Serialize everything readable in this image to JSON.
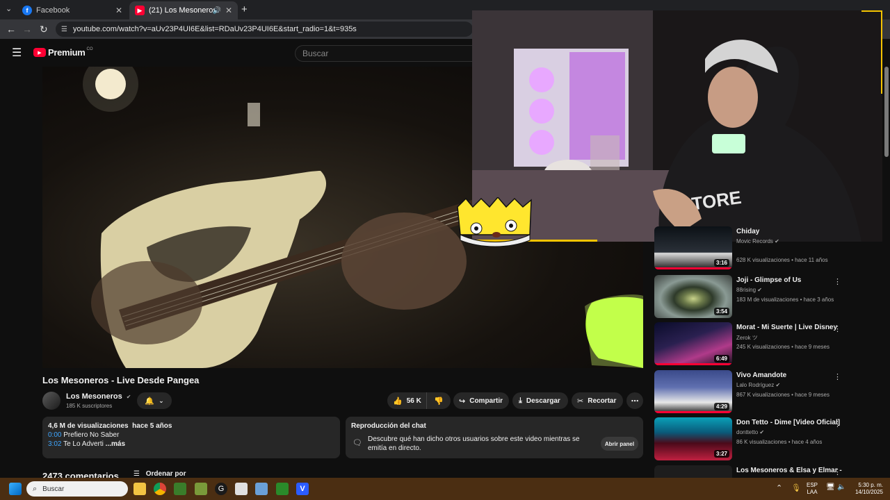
{
  "browser": {
    "tabs": [
      {
        "label": "Facebook",
        "active": false
      },
      {
        "label": "(21) Los Mesoneros - Live D",
        "active": true
      }
    ],
    "url": "youtube.com/watch?v=aUv23P4UI6E&list=RDaUv23P4UI6E&start_radio=1&t=935s"
  },
  "header": {
    "logo": "Premium",
    "region": "CO",
    "search_placeholder": "Buscar"
  },
  "video": {
    "title": "Los Mesoneros - Live Desde Pangea",
    "channel": "Los Mesoneros",
    "subscribers": "185 K suscriptores",
    "likes": "56 K",
    "share_label": "Compartir",
    "download_label": "Descargar",
    "clip_label": "Recortar"
  },
  "description": {
    "views_time": "4,6 M de visualizaciones  hace 5 años",
    "chapters": [
      {
        "time": "0:00",
        "title": "Prefiero No Saber"
      },
      {
        "time": "3:02",
        "title": "Te Lo Adverti"
      }
    ],
    "more": "...más"
  },
  "chat_replay": {
    "title": "Reproducción del chat",
    "text": "Descubre qué han dicho otros usuarios sobre este video mientras se emitía en directo.",
    "button": "Abrir panel"
  },
  "comments": {
    "count_label": "2473 comentarios",
    "sort_label": "Ordenar por"
  },
  "recommendations": [
    {
      "title": "Chiday",
      "channel": "Movic Records",
      "verified": true,
      "meta": "628 K visualizaciones • hace 11 años",
      "duration": "3:16"
    },
    {
      "title": "Joji -  Glimpse of Us",
      "channel": "88rising",
      "verified": true,
      "meta": "183 M de visualizaciones • hace 3 años",
      "duration": "3:54"
    },
    {
      "title": "Morat - Mi Suerte | Live Disney",
      "channel": "Zerok ツ",
      "verified": false,
      "meta": "245 K visualizaciones • hace 9 meses",
      "duration": "6:49"
    },
    {
      "title": "Vivo Amandote",
      "channel": "Lalo Rodríguez",
      "verified": true,
      "meta": "867 K visualizaciones • hace 9 meses",
      "duration": "4:29"
    },
    {
      "title": "Don Tetto -  Dime [Video Oficial]",
      "channel": "donttetto",
      "verified": true,
      "meta": "86 K visualizaciones • hace 4 años",
      "duration": "3:27"
    },
    {
      "title": "Los Mesoneros & Elsa y Elmar -",
      "channel": "",
      "verified": false,
      "meta": "",
      "duration": ""
    }
  ],
  "taskbar": {
    "search_placeholder": "Buscar",
    "lang_line1": "ESP",
    "lang_line2": "LAA",
    "time": "5:30 p. m.",
    "date": "14/10/2025"
  },
  "colors": {
    "accent": "#ff0033",
    "overlay_border": "#f5c400",
    "taskbar": "#4b2e12"
  }
}
